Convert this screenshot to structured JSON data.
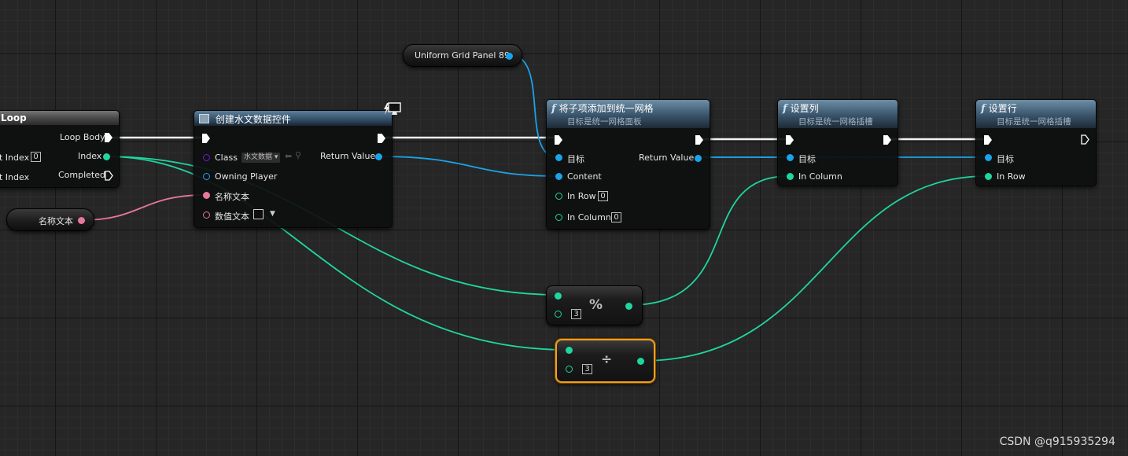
{
  "colors": {
    "exec": "#ffffff",
    "object_pin": "#1aa3e8",
    "int_pin": "#1fd6a0",
    "text_pin": "#e9779d",
    "class_pin": "#6a1fd4",
    "selected_outline": "#f0a020"
  },
  "loop_node": {
    "title": "Loop",
    "loop_body": "Loop Body",
    "index_out": "Index",
    "completed": "Completed",
    "first_index": "t Index",
    "first_index_value": "0",
    "last_index": "t Index"
  },
  "create_widget": {
    "title": "创建水文数据控件",
    "class_label": "Class",
    "class_value": "水文数据",
    "owning_player": "Owning Player",
    "name_text": "名称文本",
    "value_text": "数值文本",
    "return_value": "Return Value"
  },
  "name_text_var": {
    "label": "名称文本"
  },
  "grid_panel_var": {
    "label": "Uniform Grid Panel 89"
  },
  "add_child": {
    "title": "将子项添加到统一网格",
    "subtitle": "目标是统一网格面板",
    "target": "目标",
    "content": "Content",
    "in_row": "In Row",
    "in_row_value": "0",
    "in_column": "In Column",
    "in_column_value": "0",
    "return_value": "Return Value"
  },
  "set_column": {
    "title": "设置列",
    "subtitle": "目标是统一网格插槽",
    "target": "目标",
    "in_column": "In Column"
  },
  "set_row": {
    "title": "设置行",
    "subtitle": "目标是统一网格插槽",
    "target": "目标",
    "in_row": "In Row"
  },
  "modulo_node": {
    "symbol": "%",
    "value": "3"
  },
  "divide_node": {
    "symbol": "÷",
    "value": "3"
  },
  "watermark": "CSDN @q915935294"
}
